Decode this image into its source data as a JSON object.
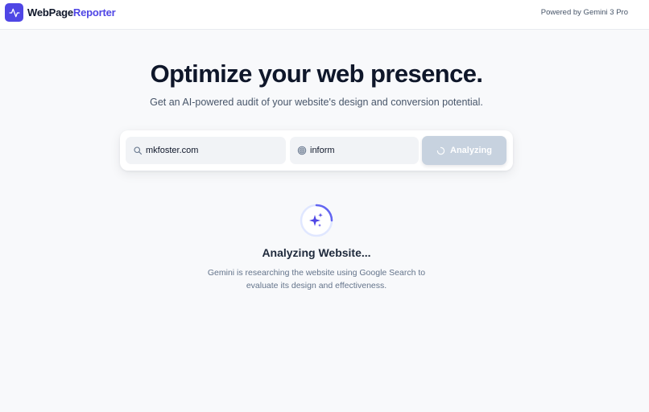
{
  "header": {
    "brand_part1": "WebPage",
    "brand_part2": "Reporter",
    "logo_icon": "activity-pulse-icon",
    "powered_by": "Powered by Gemini 3 Pro"
  },
  "hero": {
    "title": "Optimize your web presence.",
    "subtitle": "Get an AI-powered audit of your website's design and conversion potential."
  },
  "search": {
    "url_value": "mkfoster.com",
    "url_icon": "search-icon",
    "goal_value": "inform",
    "goal_icon": "target-icon",
    "button_label": "Analyzing",
    "button_state": "disabled-loading"
  },
  "status": {
    "title": "Analyzing Website...",
    "description": "Gemini is researching the website using Google Search to evaluate its design and effectiveness.",
    "icon": "sparkles-icon"
  },
  "colors": {
    "accent": "#4f46e5",
    "background": "#f8f9fb",
    "button_disabled": "#c7d2df"
  }
}
